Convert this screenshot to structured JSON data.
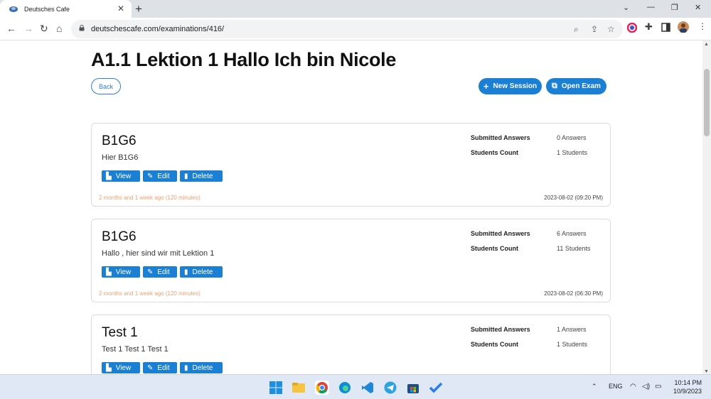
{
  "browser": {
    "tab_title": "Deutsches Cafe",
    "url": "deutschescafe.com/examinations/416/"
  },
  "page": {
    "title": "A1.1 Lektion 1 Hallo Ich bin Nicole",
    "back_label": "Back",
    "new_session_label": "New Session",
    "open_exam_label": "Open Exam"
  },
  "labels": {
    "submitted": "Submitted Answers",
    "students": "Students Count",
    "view": "View",
    "edit": "Edit",
    "delete": "Delete"
  },
  "sessions": [
    {
      "title": "B1G6",
      "description": "Hier B1G6",
      "answers": "0 Answers",
      "students": "1 Students",
      "ago": "2 months and 1 week ago (120 minutes)",
      "date": "2023-08-02 (09:20 PM)"
    },
    {
      "title": "B1G6",
      "description": "Hallo , hier sind wir mit Lektion 1",
      "answers": "6 Answers",
      "students": "11 Students",
      "ago": "2 months and 1 week ago (120 minutes)",
      "date": "2023-08-02 (06:30 PM)"
    },
    {
      "title": "Test 1",
      "description": "Test 1 Test 1 Test 1",
      "answers": "1 Answers",
      "students": "1 Students",
      "ago": "",
      "date": ""
    }
  ],
  "taskbar": {
    "language": "ENG",
    "time": "10:14 PM",
    "date": "10/9/2023"
  },
  "colors": {
    "primary": "#1b7fd4",
    "timeago": "#f0a070"
  }
}
